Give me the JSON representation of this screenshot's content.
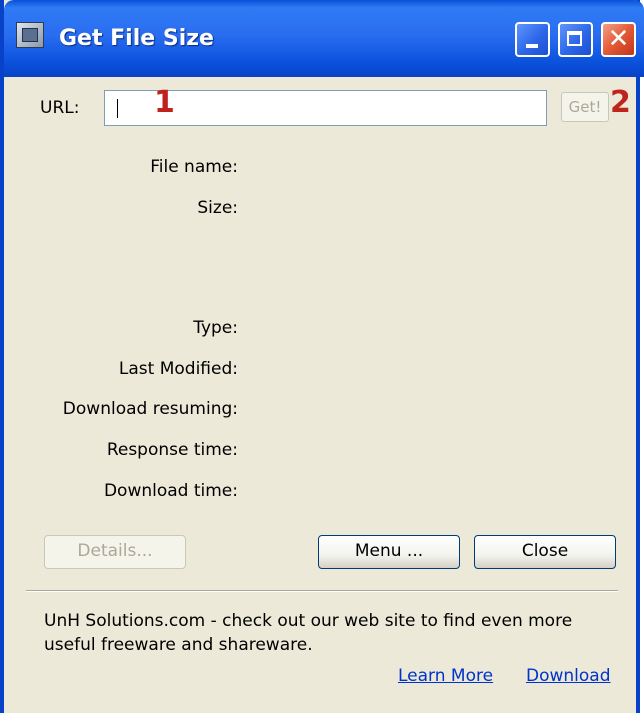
{
  "window": {
    "title": "Get File Size"
  },
  "form": {
    "url_label": "URL:",
    "url_value": "",
    "get_label": "Get!"
  },
  "annotations": {
    "marker_1": "1",
    "marker_2": "2"
  },
  "fields": {
    "file_name": "File name:",
    "size": "Size:",
    "type": "Type:",
    "last_modified": "Last Modified:",
    "download_resuming": "Download resuming:",
    "response_time": "Response time:",
    "download_time": "Download time:"
  },
  "buttons": {
    "details": "Details...",
    "menu": "Menu ...",
    "close": "Close"
  },
  "footer": {
    "text": "UnH Solutions.com - check out our web site to find even more useful freeware and shareware.",
    "learn_more": "Learn More",
    "download": "Download"
  },
  "colors": {
    "titlebar": "#0a4fd8",
    "dialog_bg": "#ece9d8",
    "link": "#0033cc",
    "marker": "#c0231c"
  }
}
